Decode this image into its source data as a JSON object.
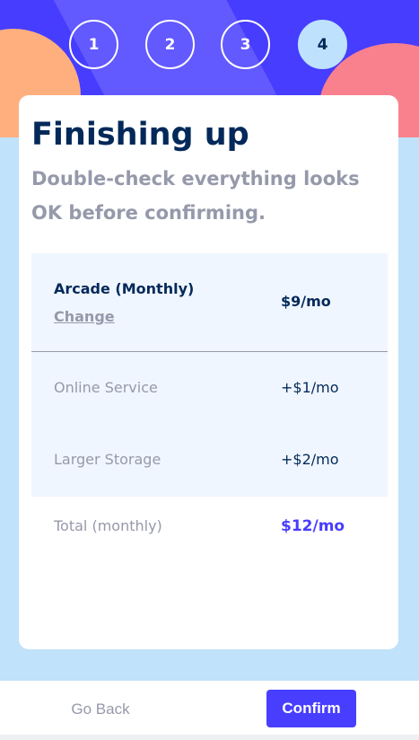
{
  "steps": [
    "1",
    "2",
    "3",
    "4"
  ],
  "active_step": 4,
  "heading": {
    "title": "Finishing up",
    "subtitle": "Double-check everything looks OK before confirming."
  },
  "summary": {
    "plan_name": "Arcade (Monthly)",
    "change_label": "Change",
    "plan_price": "$9/mo",
    "addons": [
      {
        "name": "Online Service",
        "price": "+$1/mo"
      },
      {
        "name": "Larger Storage",
        "price": "+$2/mo"
      }
    ],
    "total_label": "Total (monthly)",
    "total_price": "$12/mo"
  },
  "footer": {
    "back_label": "Go Back",
    "confirm_label": "Confirm"
  },
  "colors": {
    "primary": "#473dff",
    "marine": "#022959",
    "grey": "#9699aa",
    "light_bg": "#f0f6ff",
    "page_bg": "#c0e2fa"
  }
}
